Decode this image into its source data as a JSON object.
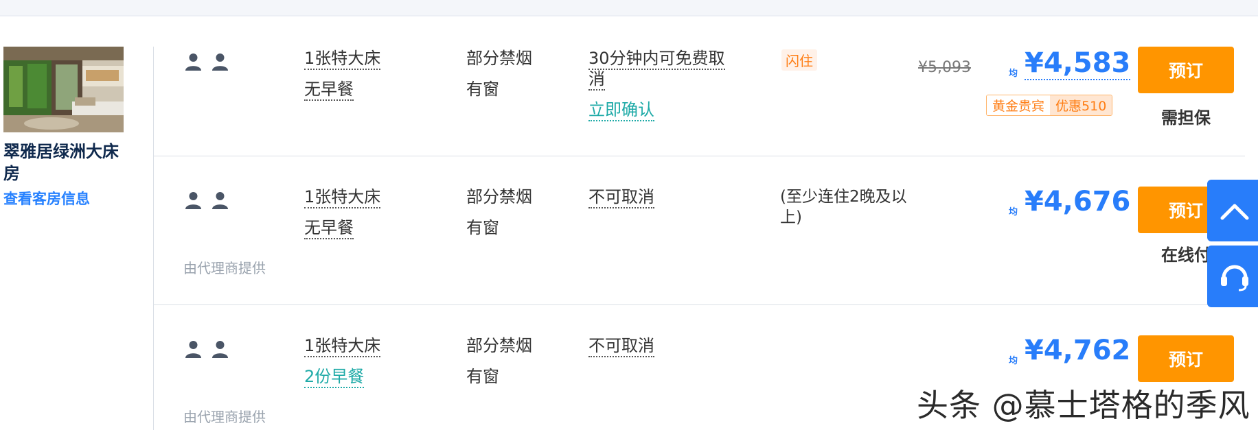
{
  "room": {
    "name": "翠雅居绿洲大床房",
    "link_label": "查看客房信息"
  },
  "rows": [
    {
      "bed": "1张特大床",
      "meal": "无早餐",
      "smoking": "部分禁烟",
      "window": "有窗",
      "cancel": "30分钟内可免费取消",
      "confirm": "立即确认",
      "flash_tag": "闪住",
      "original_price": "¥5,093",
      "avg_label": "均",
      "price": "¥4,583",
      "badge_tier": "黄金贵宾",
      "badge_discount": "优惠510",
      "book_label": "预订",
      "pay_note": "需担保"
    },
    {
      "bed": "1张特大床",
      "meal": "无早餐",
      "smoking": "部分禁烟",
      "window": "有窗",
      "cancel": "不可取消",
      "stay_note": "(至少连住2晚及以上)",
      "agent": "由代理商提供",
      "avg_label": "均",
      "price": "¥4,676",
      "book_label": "预订",
      "pay_note": "在线付"
    },
    {
      "bed": "1张特大床",
      "meal": "2份早餐",
      "smoking": "部分禁烟",
      "window": "有窗",
      "cancel": "不可取消",
      "agent": "由代理商提供",
      "avg_label": "均",
      "price": "¥4,762",
      "book_label": "预订"
    }
  ],
  "floating": {
    "top_icon": "chevron-up-icon",
    "support_icon": "headset-icon"
  },
  "watermark": "头条 @慕士塔格的季风",
  "colors": {
    "accent_blue": "#287dfa",
    "book_orange": "#ff9500",
    "teal": "#1eaaa7",
    "dark_navy": "#0f294d"
  }
}
